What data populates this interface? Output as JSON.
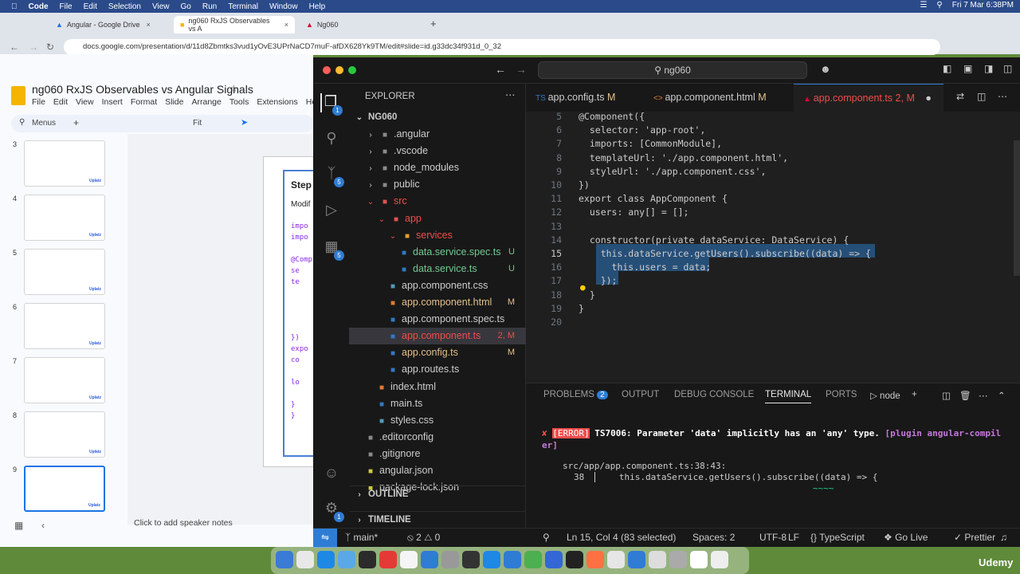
{
  "menubar": {
    "app": "Code",
    "items": [
      "File",
      "Edit",
      "Selection",
      "View",
      "Go",
      "Run",
      "Terminal",
      "Window",
      "Help"
    ],
    "datetime": "Fri 7 Mar  6:38PM"
  },
  "browser": {
    "tabs": [
      {
        "label": "Angular - Google Drive"
      },
      {
        "label": "ng060 RxJS Observables vs A"
      },
      {
        "label": "Ng060"
      }
    ],
    "url": "docs.google.com/presentation/d/11d8Zbmtks3vud1yOvE3UPrNaCD7muF-afDX628Yk9TM/edit#slide=id.g33dc34f931d_0_32"
  },
  "slides": {
    "title": "ng060 RxJS Observables vs Angular Signals",
    "menu": [
      "File",
      "Edit",
      "View",
      "Insert",
      "Format",
      "Slide",
      "Arrange",
      "Tools",
      "Extensions",
      "Help"
    ],
    "toolbar": {
      "menus": "Menus",
      "zoom": "Fit"
    },
    "thumb_numbers": [
      "3",
      "4",
      "5",
      "6",
      "7",
      "8",
      "9"
    ],
    "thumb_logo": "Uplatz",
    "canvas_title": "Step",
    "canvas_sub": "Modif",
    "canvas_code": [
      "impo",
      "impo",
      "",
      "@Comp",
      "se",
      "te",
      "",
      "",
      "",
      "",
      "})",
      "expo",
      "co",
      "",
      "lo",
      "",
      "}",
      "}"
    ],
    "speaker_notes": "Click to add speaker notes"
  },
  "vscode": {
    "search": "ng060",
    "explorer_title": "EXPLORER",
    "root": "NG060",
    "tree": [
      {
        "name": ".angular",
        "status": "",
        "indent": 1,
        "type": "folder-closed"
      },
      {
        "name": ".vscode",
        "status": "",
        "indent": 1,
        "type": "folder-closed"
      },
      {
        "name": "node_modules",
        "status": "",
        "indent": 1,
        "type": "folder-closed"
      },
      {
        "name": "public",
        "status": "",
        "indent": 1,
        "type": "folder-closed"
      },
      {
        "name": "src",
        "status": "",
        "indent": 1,
        "type": "folder-open"
      },
      {
        "name": "app",
        "status": "",
        "indent": 2,
        "type": "folder-open"
      },
      {
        "name": "services",
        "status": "",
        "indent": 3,
        "type": "folder-open"
      },
      {
        "name": "data.service.spec.ts",
        "status": "U",
        "indent": 4,
        "type": "file"
      },
      {
        "name": "data.service.ts",
        "status": "U",
        "indent": 4,
        "type": "file"
      },
      {
        "name": "app.component.css",
        "status": "",
        "indent": 3,
        "type": "file"
      },
      {
        "name": "app.component.html",
        "status": "M",
        "indent": 3,
        "type": "file"
      },
      {
        "name": "app.component.spec.ts",
        "status": "",
        "indent": 3,
        "type": "file"
      },
      {
        "name": "app.component.ts",
        "status": "2, M",
        "indent": 3,
        "type": "file"
      },
      {
        "name": "app.config.ts",
        "status": "M",
        "indent": 3,
        "type": "file"
      },
      {
        "name": "app.routes.ts",
        "status": "",
        "indent": 3,
        "type": "file"
      },
      {
        "name": "index.html",
        "status": "",
        "indent": 2,
        "type": "file"
      },
      {
        "name": "main.ts",
        "status": "",
        "indent": 2,
        "type": "file"
      },
      {
        "name": "styles.css",
        "status": "",
        "indent": 2,
        "type": "file"
      },
      {
        "name": ".editorconfig",
        "status": "",
        "indent": 1,
        "type": "file"
      },
      {
        "name": ".gitignore",
        "status": "",
        "indent": 1,
        "type": "file"
      },
      {
        "name": "angular.json",
        "status": "",
        "indent": 1,
        "type": "file"
      },
      {
        "name": "package-lock.json",
        "status": "",
        "indent": 1,
        "type": "file"
      }
    ],
    "outline": "OUTLINE",
    "timeline": "TIMELINE",
    "editor_tabs": [
      {
        "label": "app.config.ts",
        "status": "M"
      },
      {
        "label": "app.component.html",
        "status": "M"
      },
      {
        "label": "app.component.ts",
        "status": "2, M"
      }
    ],
    "line_numbers": [
      "5",
      "6",
      "7",
      "8",
      "9",
      "10",
      "11",
      "12",
      "13",
      "14",
      "15",
      "16",
      "17",
      "18",
      "19",
      "20"
    ],
    "code_lines": [
      "@Component({",
      "  selector: 'app-root',",
      "  imports: [CommonModule],",
      "  templateUrl: './app.component.html',",
      "  styleUrl: './app.component.css',",
      "})",
      "export class AppComponent {",
      "  users: any[] = [];",
      "",
      "  constructor(private dataService: DataService) {",
      "    this.dataService.getUsers().subscribe((data) => {",
      "      this.users = data;",
      "    });",
      "  }",
      "}",
      ""
    ],
    "panel_tabs": [
      "PROBLEMS",
      "OUTPUT",
      "DEBUG CONSOLE",
      "TERMINAL",
      "PORTS"
    ],
    "problems_count": "2",
    "terminal_shell": "node",
    "terminal": {
      "error_tag": "[ERROR]",
      "error_msg": "TS7006: Parameter 'data' implicitly has an 'any' type.",
      "plugin": "[plugin angular-compil",
      "plugin_cont": "er]",
      "location": "src/app/app.component.ts:38:43:",
      "line_no": "38",
      "line_code": "this.dataService.getUsers().subscribe((data) => {",
      "squiggle": "~~~~"
    },
    "status": {
      "branch": "main*",
      "errors": "2",
      "warnings": "0",
      "position": "Ln 15, Col 4 (83 selected)",
      "spaces": "Spaces: 2",
      "encoding": "UTF-8",
      "eol": "LF",
      "language": "TypeScript",
      "golive": "Go Live",
      "prettier": "Prettier"
    }
  },
  "watermark": "Udemy",
  "colors": {
    "accent": "#2f7cd4",
    "error": "#f14c4c",
    "modified": "#e2c08d"
  }
}
